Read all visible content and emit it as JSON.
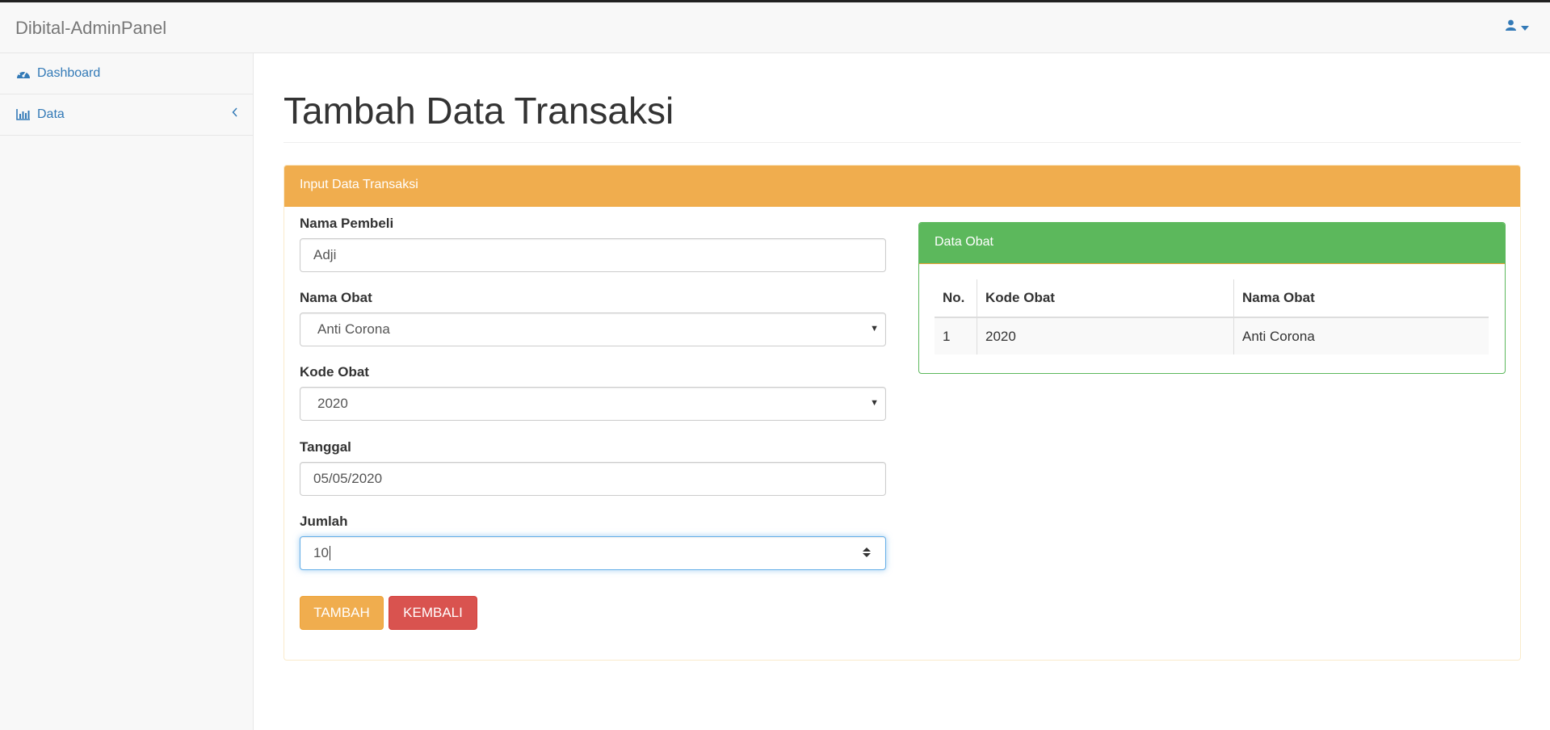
{
  "app": {
    "brand": "Dibital-AdminPanel"
  },
  "navbar": {
    "user_icon": "user-icon",
    "dropdown_icon": "caret-down-icon"
  },
  "sidebar": {
    "items": [
      {
        "label": "Dashboard",
        "icon": "dashboard-icon"
      },
      {
        "label": "Data",
        "icon": "bar-chart-icon",
        "chevron": "chevron-left-icon"
      }
    ]
  },
  "page": {
    "title": "Tambah Data Transaksi"
  },
  "form_panel": {
    "heading": "Input Data Transaksi",
    "fields": {
      "nama_pembeli": {
        "label": "Nama Pembeli",
        "value": "Adji"
      },
      "nama_obat": {
        "label": "Nama Obat",
        "value": "Anti Corona"
      },
      "kode_obat": {
        "label": "Kode Obat",
        "value": "2020"
      },
      "tanggal": {
        "label": "Tanggal",
        "value": "05/05/2020"
      },
      "jumlah": {
        "label": "Jumlah",
        "value": "10"
      }
    },
    "buttons": {
      "submit": "TAMBAH",
      "back": "KEMBALI"
    }
  },
  "obat_panel": {
    "heading": "Data Obat",
    "columns": [
      "No.",
      "Kode Obat",
      "Nama Obat"
    ],
    "rows": [
      [
        "1",
        "2020",
        "Anti Corona"
      ]
    ]
  },
  "colors": {
    "warning": "#f0ad4e",
    "danger": "#d9534f",
    "success": "#5cb85c",
    "link": "#337ab7"
  }
}
